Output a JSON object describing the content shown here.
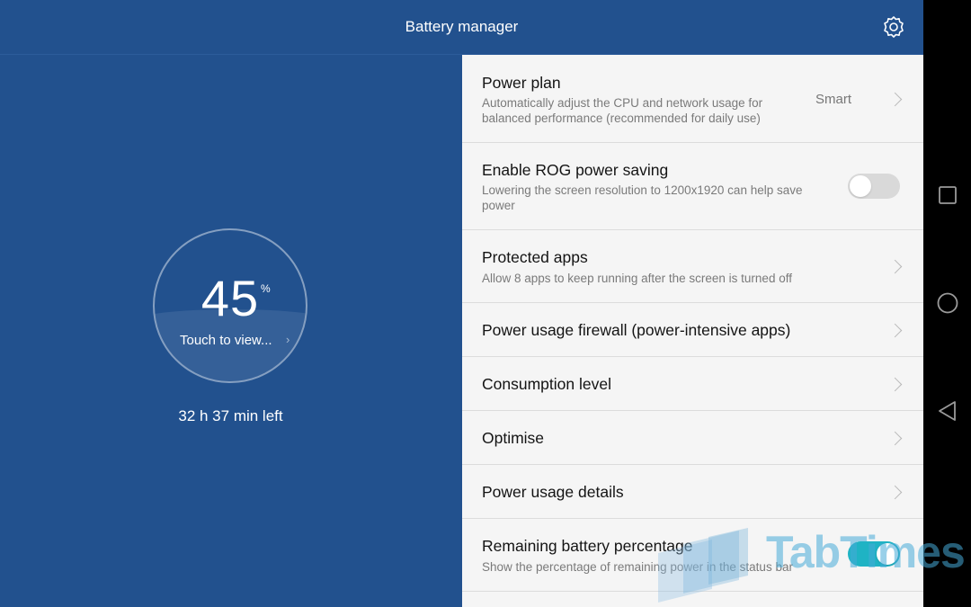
{
  "header": {
    "title": "Battery manager",
    "settings_icon": "gear-icon"
  },
  "battery": {
    "percent": "45",
    "percent_sign": "%",
    "level_fraction": 0.45,
    "touch_label": "Touch to view...",
    "time_left": "32 h 37 min left"
  },
  "settings": {
    "items": [
      {
        "title": "Power plan",
        "subtitle": "Automatically adjust the CPU and network usage for balanced performance (recommended for daily use)",
        "value": "Smart",
        "control": "chevron"
      },
      {
        "title": "Enable ROG power saving",
        "subtitle": "Lowering the screen resolution to 1200x1920 can help save power",
        "control": "toggle",
        "checked": false
      },
      {
        "title": "Protected apps",
        "subtitle": "Allow 8 apps to keep running after the screen is turned off",
        "control": "chevron"
      },
      {
        "title": "Power usage firewall (power-intensive apps)",
        "control": "chevron"
      },
      {
        "title": "Consumption level",
        "control": "chevron"
      },
      {
        "title": "Optimise",
        "control": "chevron"
      },
      {
        "title": "Power usage details",
        "control": "chevron"
      },
      {
        "title": "Remaining battery percentage",
        "subtitle": "Show the percentage of remaining power in the status bar",
        "control": "toggle",
        "checked": true
      }
    ]
  },
  "navbar": {
    "buttons": [
      "recents-icon",
      "home-icon",
      "back-icon"
    ]
  },
  "watermark": {
    "text": "TabTimes"
  },
  "colors": {
    "primary": "#22518e",
    "toggle_on": "#1fb3c4",
    "toggle_off": "#d9d9d9",
    "list_background": "#f5f5f5"
  }
}
